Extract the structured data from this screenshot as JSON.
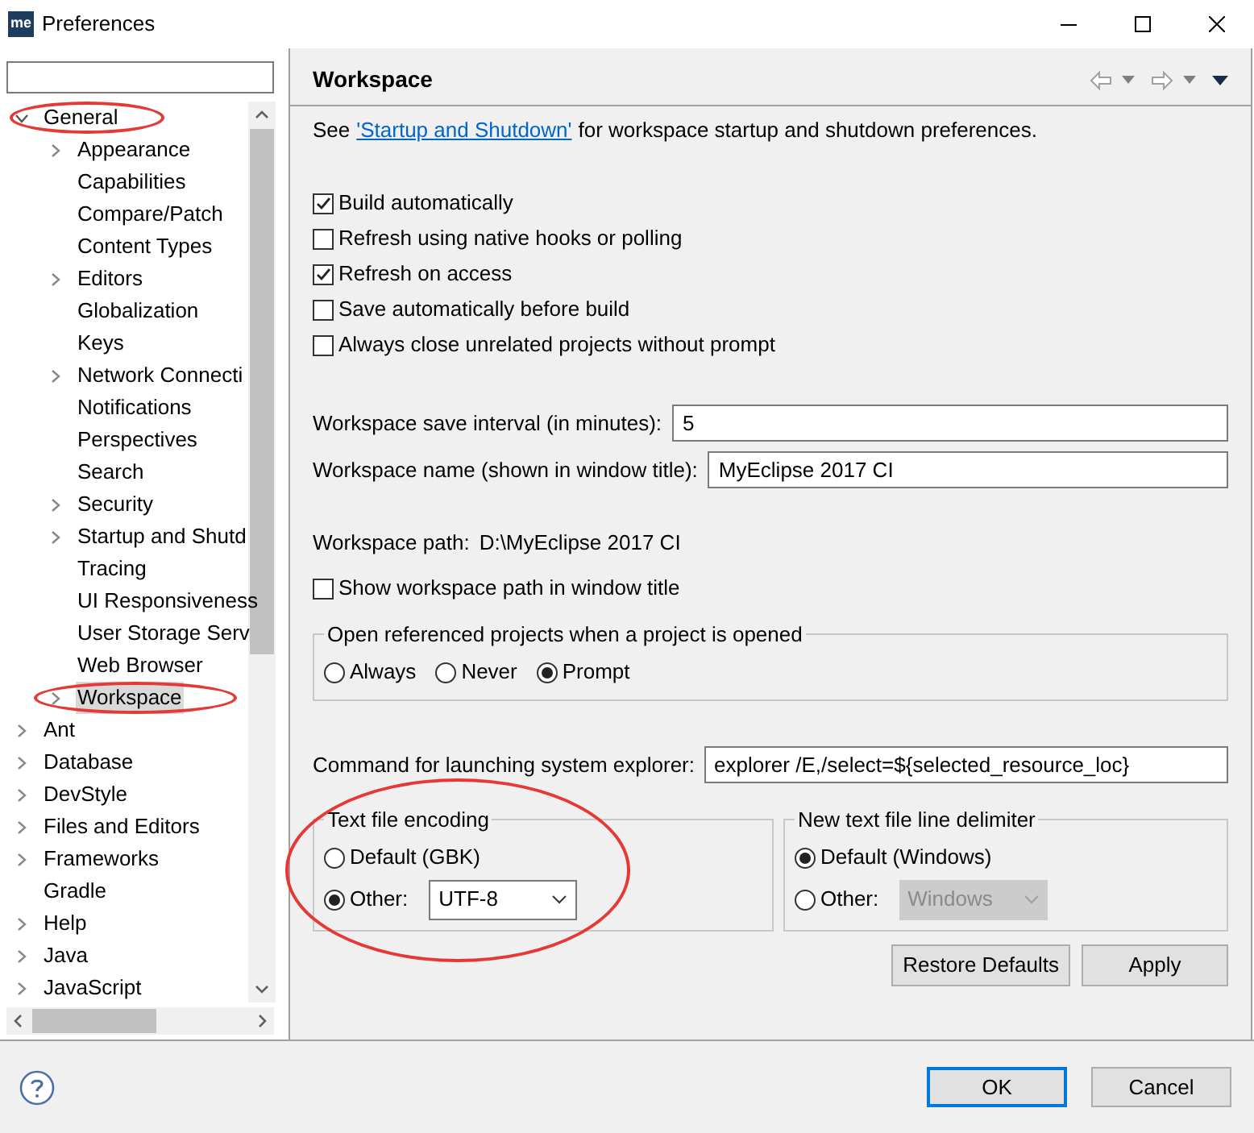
{
  "window": {
    "logo": "me",
    "title": "Preferences"
  },
  "tree": [
    {
      "label": "General",
      "expandable": true,
      "expanded": true,
      "selected": false,
      "circled": true,
      "children": [
        {
          "label": "Appearance",
          "expandable": true,
          "expanded": false,
          "selected": false,
          "circled": false
        },
        {
          "label": "Capabilities",
          "expandable": false,
          "selected": false,
          "circled": false
        },
        {
          "label": "Compare/Patch",
          "expandable": false,
          "selected": false,
          "circled": false
        },
        {
          "label": "Content Types",
          "expandable": false,
          "selected": false,
          "circled": false
        },
        {
          "label": "Editors",
          "expandable": true,
          "expanded": false,
          "selected": false,
          "circled": false
        },
        {
          "label": "Globalization",
          "expandable": false,
          "selected": false,
          "circled": false
        },
        {
          "label": "Keys",
          "expandable": false,
          "selected": false,
          "circled": false
        },
        {
          "label": "Network Connecti",
          "expandable": true,
          "expanded": false,
          "selected": false,
          "circled": false
        },
        {
          "label": "Notifications",
          "expandable": false,
          "selected": false,
          "circled": false
        },
        {
          "label": "Perspectives",
          "expandable": false,
          "selected": false,
          "circled": false
        },
        {
          "label": "Search",
          "expandable": false,
          "selected": false,
          "circled": false
        },
        {
          "label": "Security",
          "expandable": true,
          "expanded": false,
          "selected": false,
          "circled": false
        },
        {
          "label": "Startup and Shutd",
          "expandable": true,
          "expanded": false,
          "selected": false,
          "circled": false
        },
        {
          "label": "Tracing",
          "expandable": false,
          "selected": false,
          "circled": false
        },
        {
          "label": "UI Responsiveness",
          "expandable": false,
          "selected": false,
          "circled": false
        },
        {
          "label": "User Storage Serv",
          "expandable": false,
          "selected": false,
          "circled": false
        },
        {
          "label": "Web Browser",
          "expandable": false,
          "selected": false,
          "circled": false
        },
        {
          "label": "Workspace",
          "expandable": true,
          "expanded": false,
          "selected": true,
          "circled": true
        }
      ]
    },
    {
      "label": "Ant",
      "expandable": true,
      "expanded": false,
      "selected": false,
      "circled": false
    },
    {
      "label": "Database",
      "expandable": true,
      "expanded": false,
      "selected": false,
      "circled": false
    },
    {
      "label": "DevStyle",
      "expandable": true,
      "expanded": false,
      "selected": false,
      "circled": false
    },
    {
      "label": "Files and Editors",
      "expandable": true,
      "expanded": false,
      "selected": false,
      "circled": false
    },
    {
      "label": "Frameworks",
      "expandable": true,
      "expanded": false,
      "selected": false,
      "circled": false
    },
    {
      "label": "Gradle",
      "expandable": false,
      "selected": false,
      "circled": false
    },
    {
      "label": "Help",
      "expandable": true,
      "expanded": false,
      "selected": false,
      "circled": false
    },
    {
      "label": "Java",
      "expandable": true,
      "expanded": false,
      "selected": false,
      "circled": false
    },
    {
      "label": "JavaScript",
      "expandable": true,
      "expanded": false,
      "selected": false,
      "circled": false
    }
  ],
  "page": {
    "title": "Workspace",
    "intro": {
      "before": "See",
      "link": "'Startup and Shutdown'",
      "after": "for workspace startup and shutdown preferences."
    },
    "checkboxes": [
      {
        "label": "Build automatically",
        "checked": true
      },
      {
        "label": "Refresh using native hooks or polling",
        "checked": false
      },
      {
        "label": "Refresh on access",
        "checked": true
      },
      {
        "label": "Save automatically before build",
        "checked": false
      },
      {
        "label": "Always close unrelated projects without prompt",
        "checked": false
      }
    ],
    "fields": [
      {
        "label": "Workspace save interval (in minutes):",
        "value": "5"
      },
      {
        "label": "Workspace name (shown in window title):",
        "value": "MyEclipse 2017 CI"
      }
    ],
    "path": {
      "label": "Workspace path:",
      "value": "D:\\MyEclipse 2017 CI"
    },
    "show_path": {
      "label": "Show workspace path in window title",
      "checked": false
    },
    "open_referenced": {
      "title": "Open referenced projects when a project is opened",
      "options": [
        {
          "label": "Always",
          "selected": false
        },
        {
          "label": "Never",
          "selected": false
        },
        {
          "label": "Prompt",
          "selected": true
        }
      ]
    },
    "explorer": {
      "label": "Command for launching system explorer:",
      "value": "explorer /E,/select=${selected_resource_loc}"
    },
    "encoding": {
      "title": "Text file encoding",
      "circled": true,
      "options": [
        {
          "label": "Default (GBK)",
          "selected": false
        },
        {
          "label": "Other:",
          "selected": true,
          "dropdown": "UTF-8",
          "disabled": false
        }
      ]
    },
    "delimiter": {
      "title": "New text file line delimiter",
      "circled": false,
      "options": [
        {
          "label": "Default (Windows)",
          "selected": true
        },
        {
          "label": "Other:",
          "selected": false,
          "dropdown": "Windows",
          "disabled": true
        }
      ]
    },
    "buttons": [
      "Restore Defaults",
      "Apply"
    ]
  },
  "dialog_buttons": [
    {
      "label": "OK",
      "default": true
    },
    {
      "label": "Cancel",
      "default": false
    }
  ]
}
